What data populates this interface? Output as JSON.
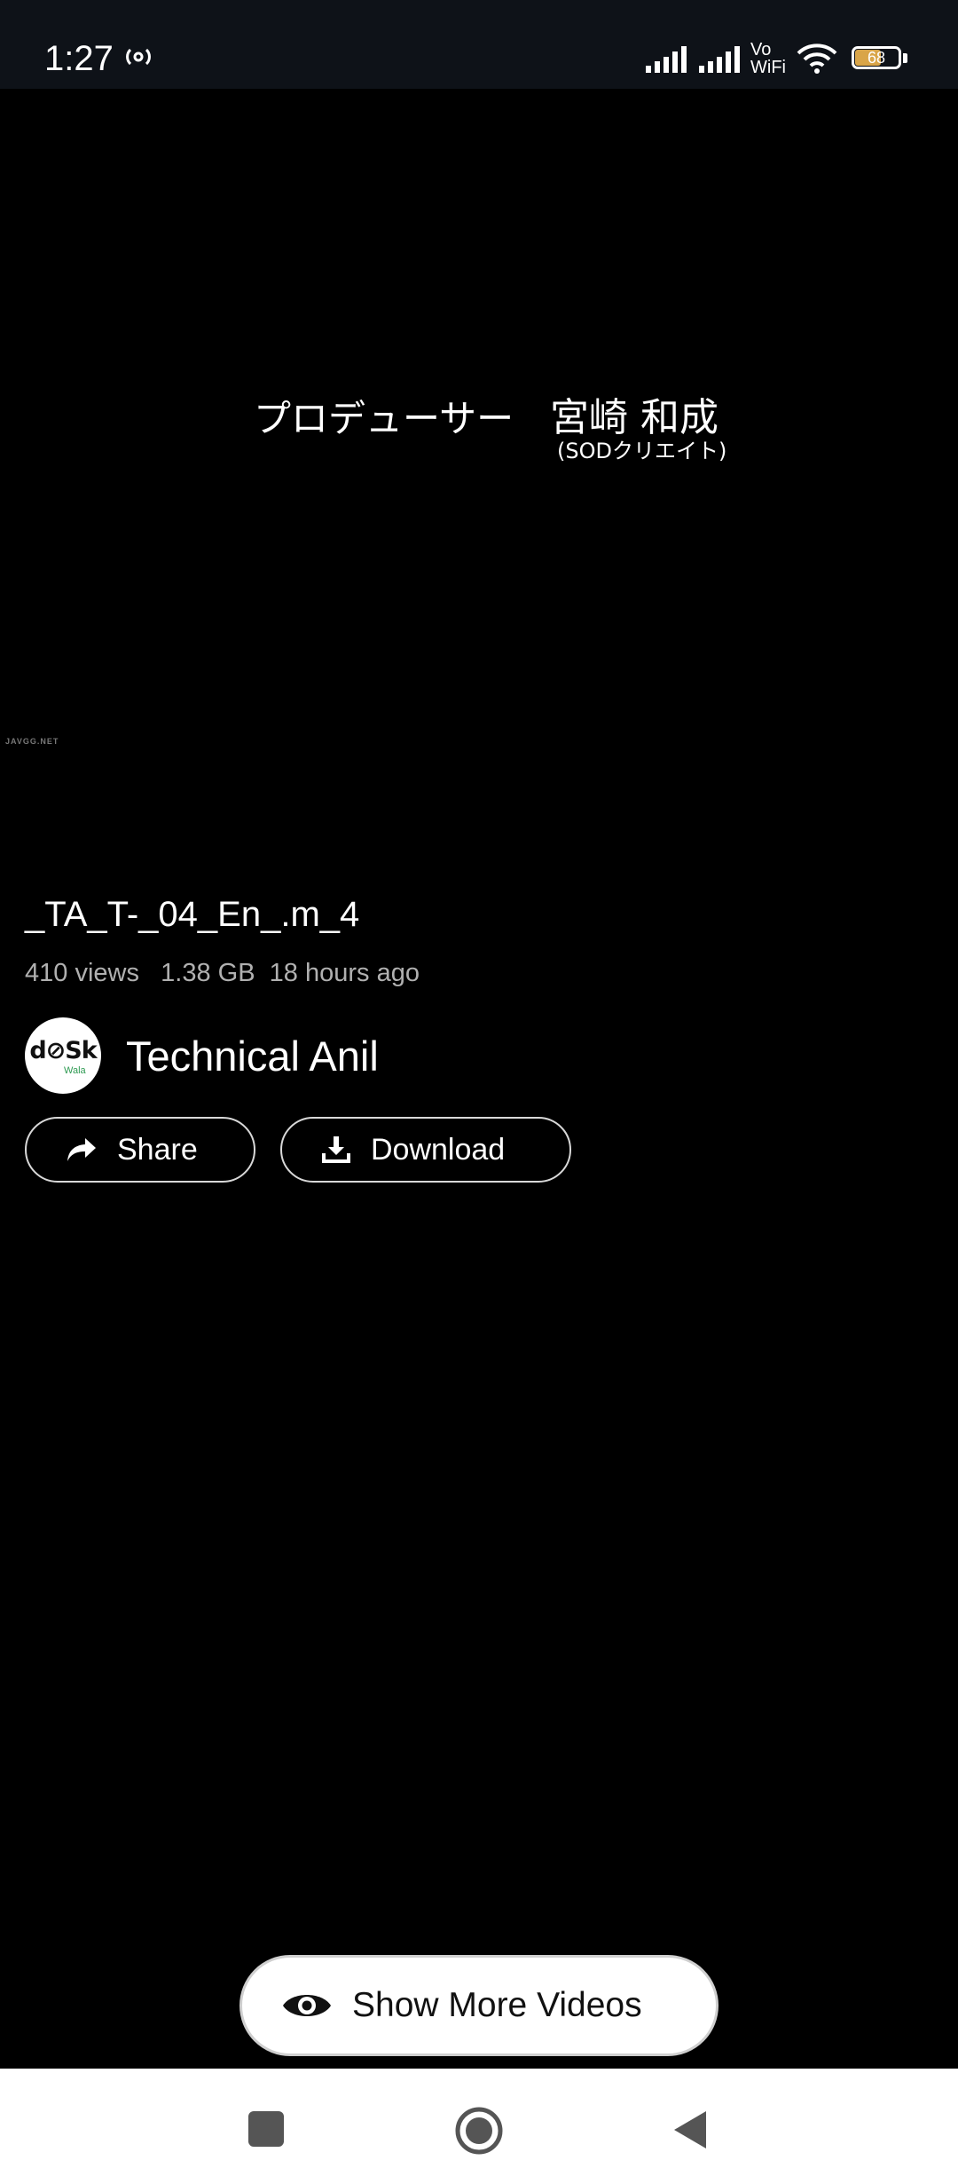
{
  "status_bar": {
    "time": "1:27",
    "network_label_top": "Vo",
    "network_label_bottom": "WiFi",
    "battery_level": "68",
    "battery_fraction": 0.68,
    "icons": [
      "hotspot-icon",
      "signal-icon",
      "signal-icon",
      "wifi-icon",
      "battery-icon"
    ]
  },
  "video": {
    "credit_role": "プロデューサー",
    "credit_name": "宮崎 和成",
    "credit_company": "(SODクリエイト)",
    "watermark": "JAVGG.NET"
  },
  "details": {
    "title": "_TA_T-_04_En_.m_4",
    "views": "410 views",
    "size": "1.38 GB",
    "age": "18 hours ago",
    "channel_avatar_text": "d⊘Sk",
    "channel_avatar_sub": "Wala",
    "channel_name": "Technical Anil"
  },
  "actions": {
    "share_label": "Share",
    "share_icon": "share-arrow-icon",
    "download_label": "Download",
    "download_icon": "download-icon"
  },
  "footer": {
    "show_more_label": "Show More Videos",
    "show_more_icon": "eye-icon",
    "accent": "#ffffff"
  },
  "nav": {
    "icons": [
      "recents-square-icon",
      "home-circle-icon",
      "back-triangle-icon"
    ]
  }
}
